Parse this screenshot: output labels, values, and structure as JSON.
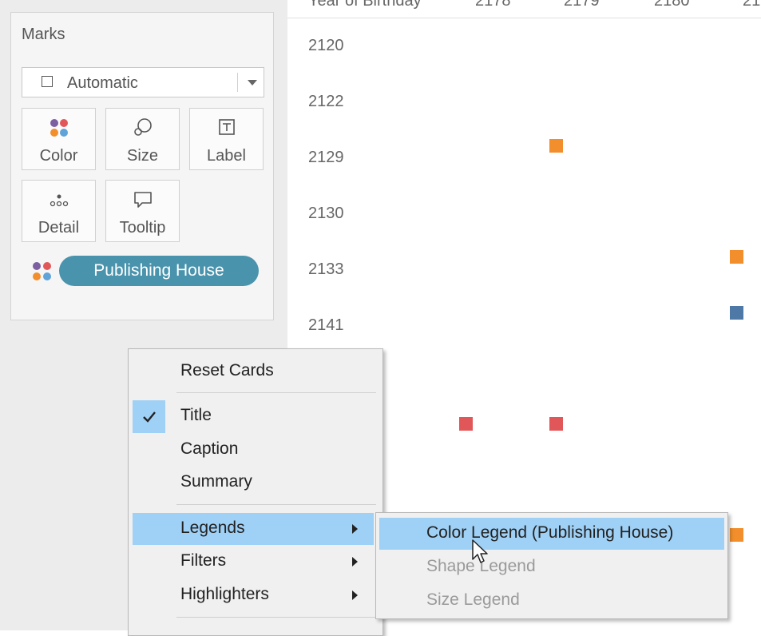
{
  "marks": {
    "title": "Marks",
    "mark_type": "Automatic",
    "buttons": {
      "color": "Color",
      "size": "Size",
      "label": "Label",
      "detail": "Detail",
      "tooltip": "Tooltip"
    },
    "color_pill": "Publishing House"
  },
  "viz": {
    "column_header": {
      "title": "Year of Birthday",
      "ticks": [
        "2178",
        "2179",
        "2180",
        "21"
      ]
    },
    "row_labels": [
      "2120",
      "2122",
      "2129",
      "2130",
      "2133",
      "2141"
    ],
    "mark_colors": {
      "orange": "#f28e2b",
      "blue": "#4e79a7",
      "red": "#e15759"
    }
  },
  "context_menu": {
    "items": [
      {
        "label": "Reset Cards"
      },
      {
        "label": "Title",
        "checked": true
      },
      {
        "label": "Caption"
      },
      {
        "label": "Summary"
      },
      {
        "label": "Legends",
        "submenu": true,
        "highlighted": true
      },
      {
        "label": "Filters",
        "submenu": true
      },
      {
        "label": "Highlighters",
        "submenu": true
      }
    ]
  },
  "legends_submenu": {
    "items": [
      {
        "label": "Color Legend (Publishing House)",
        "highlighted": true
      },
      {
        "label": "Shape Legend",
        "disabled": true
      },
      {
        "label": "Size Legend",
        "disabled": true
      }
    ]
  }
}
